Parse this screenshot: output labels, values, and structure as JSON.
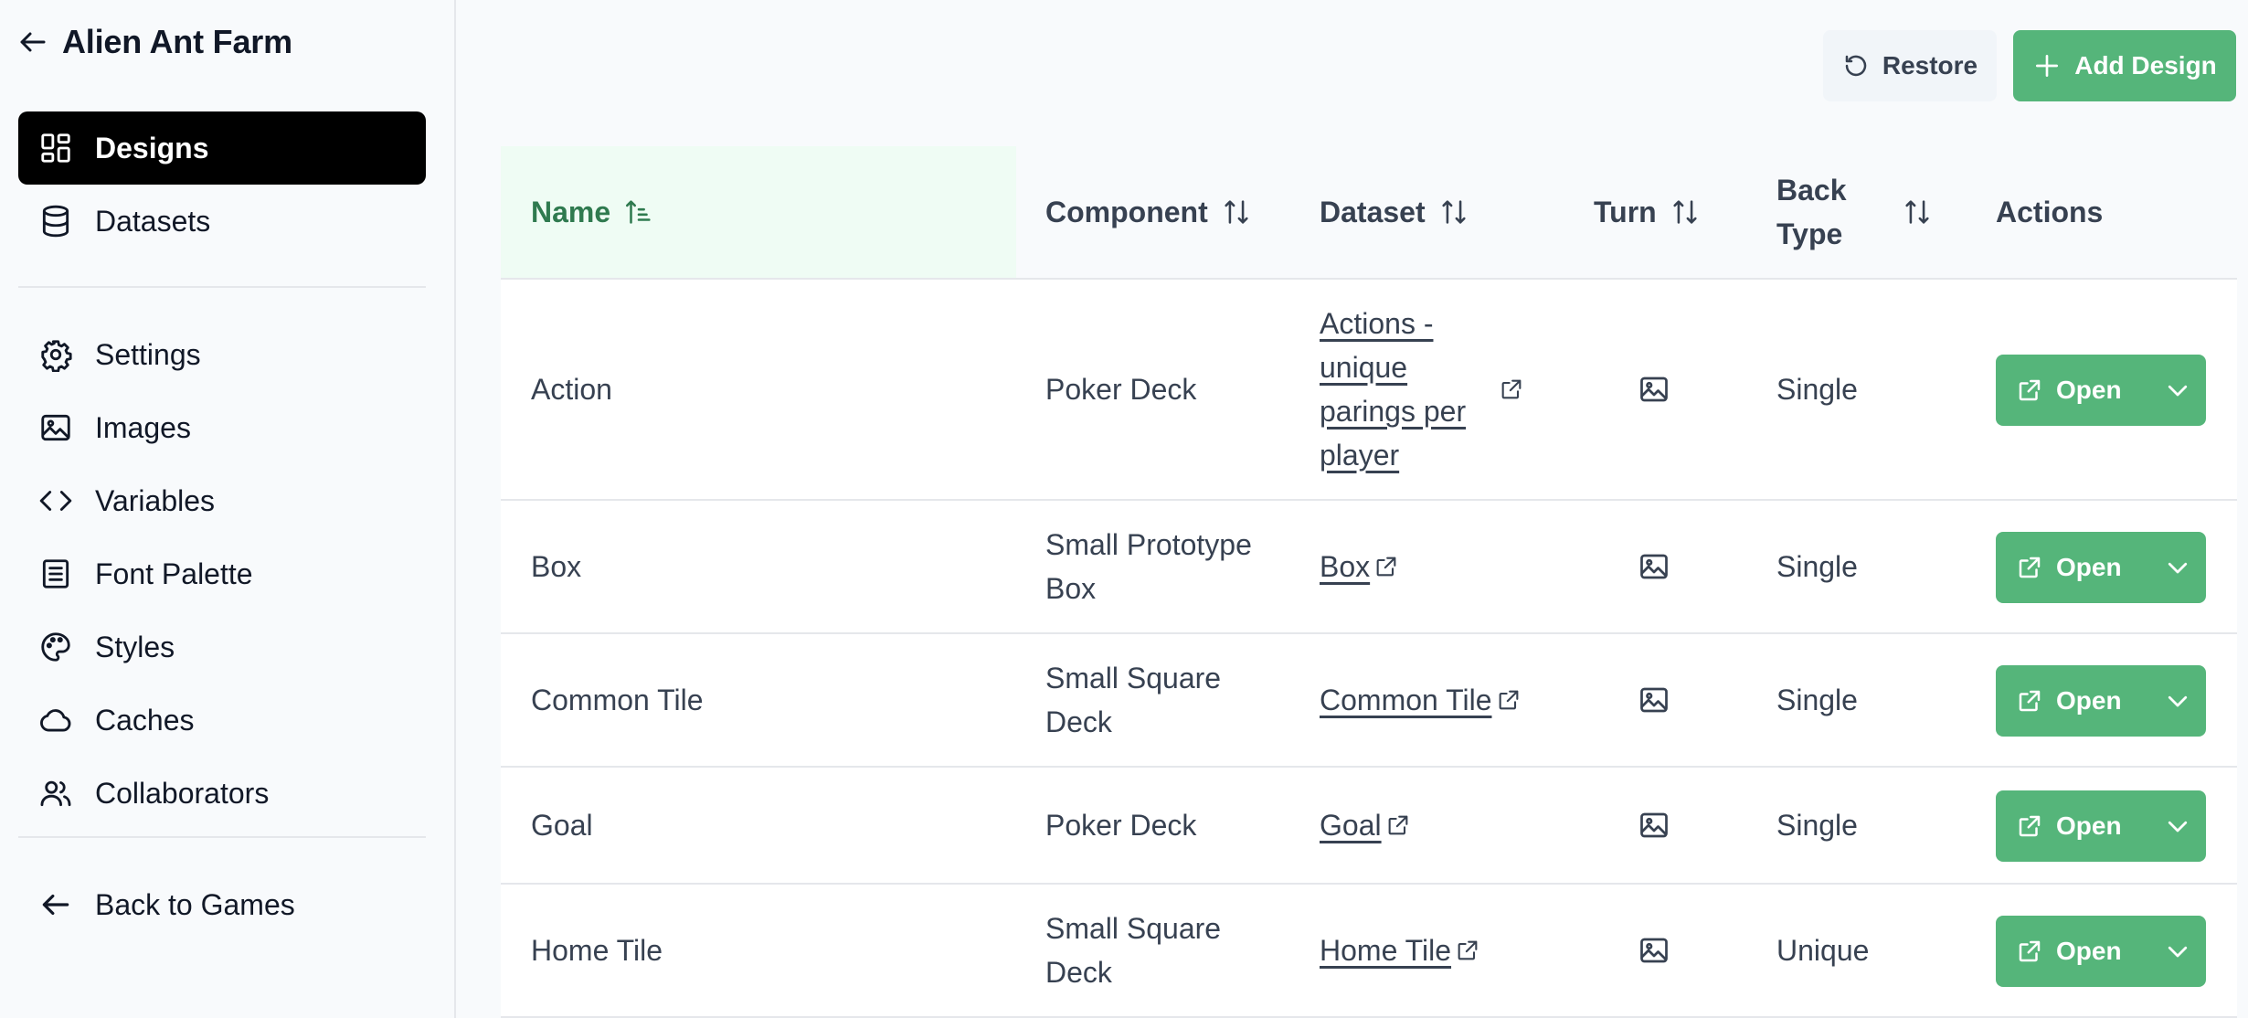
{
  "sidebar": {
    "game_title": "Alien Ant Farm",
    "nav": [
      {
        "label": "Designs",
        "icon": "designs-grid-icon",
        "active": true
      },
      {
        "label": "Datasets",
        "icon": "database-icon"
      },
      {
        "label": "Settings",
        "icon": "gear-icon"
      },
      {
        "label": "Images",
        "icon": "image-icon"
      },
      {
        "label": "Variables",
        "icon": "code-icon"
      },
      {
        "label": "Font Palette",
        "icon": "document-icon"
      },
      {
        "label": "Styles",
        "icon": "palette-icon"
      },
      {
        "label": "Caches",
        "icon": "cloud-icon"
      },
      {
        "label": "Collaborators",
        "icon": "users-icon"
      }
    ],
    "back_to_games": "Back to Games"
  },
  "toolbar": {
    "restore_label": "Restore",
    "add_label": "Add Design"
  },
  "table": {
    "columns": {
      "name": "Name",
      "component": "Component",
      "dataset": "Dataset",
      "turn": "Turn",
      "back_type_line1": "Back",
      "back_type_line2": "Type",
      "actions": "Actions"
    },
    "sorted_column": "Name",
    "rows": [
      {
        "name": "Action",
        "component": "Poker Deck",
        "dataset": "Actions - unique parings per player",
        "back_type": "Single"
      },
      {
        "name": "Box",
        "component": "Small Prototype Box",
        "dataset": "Box",
        "back_type": "Single"
      },
      {
        "name": "Common Tile",
        "component": "Small Square Deck",
        "dataset": "Common Tile",
        "back_type": "Single"
      },
      {
        "name": "Goal",
        "component": "Poker Deck",
        "dataset": "Goal",
        "back_type": "Single"
      },
      {
        "name": "Home Tile",
        "component": "Small Square Deck",
        "dataset": "Home Tile",
        "back_type": "Unique"
      }
    ],
    "open_label": "Open"
  },
  "colors": {
    "primary_green": "#55b57a",
    "sorted_header_bg": "#effcf4",
    "sorted_header_text": "#2f7a4f",
    "active_nav_bg": "#000000"
  }
}
